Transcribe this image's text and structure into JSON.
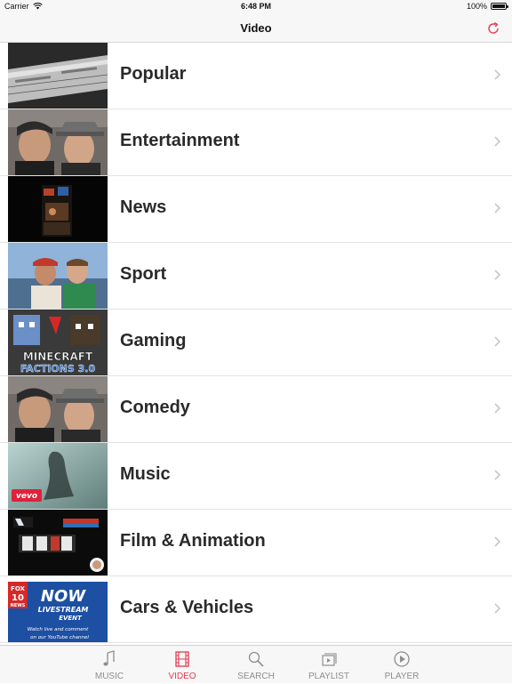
{
  "status_bar": {
    "carrier": "Carrier",
    "time": "6:48 PM",
    "battery": "100%",
    "battery_level": 1.0
  },
  "nav": {
    "title": "Video",
    "refresh_icon": "refresh-icon",
    "accent": "#e8394f"
  },
  "categories": [
    {
      "label": "Popular",
      "thumb": "popular-thumb"
    },
    {
      "label": "Entertainment",
      "thumb": "entertainment-thumb"
    },
    {
      "label": "News",
      "thumb": "news-thumb"
    },
    {
      "label": "Sport",
      "thumb": "sport-thumb"
    },
    {
      "label": "Gaming",
      "thumb": "gaming-thumb"
    },
    {
      "label": "Comedy",
      "thumb": "comedy-thumb"
    },
    {
      "label": "Music",
      "thumb": "music-thumb"
    },
    {
      "label": "Film & Animation",
      "thumb": "film-animation-thumb"
    },
    {
      "label": "Cars & Vehicles",
      "thumb": "cars-vehicles-thumb"
    }
  ],
  "thumb_text": {
    "gaming_line1": "MINECRAFT",
    "gaming_line2": "FACTIONS 3.0",
    "music_logo": "vevo",
    "cars_channel": "FOX",
    "cars_channel_num": "10",
    "cars_news": "NEWS",
    "cars_now": "NOW",
    "cars_livestream": "LIVESTREAM",
    "cars_event": "EVENT",
    "cars_caption1": "Watch live and comment",
    "cars_caption2": "on our YouTube channel"
  },
  "tabs": [
    {
      "label": "MUSIC",
      "icon": "music-note-icon",
      "active": false
    },
    {
      "label": "VIDEO",
      "icon": "film-icon",
      "active": true
    },
    {
      "label": "SEARCH",
      "icon": "search-icon",
      "active": false
    },
    {
      "label": "PLAYLIST",
      "icon": "playlist-icon",
      "active": false
    },
    {
      "label": "PLAYER",
      "icon": "play-circle-icon",
      "active": false
    }
  ]
}
